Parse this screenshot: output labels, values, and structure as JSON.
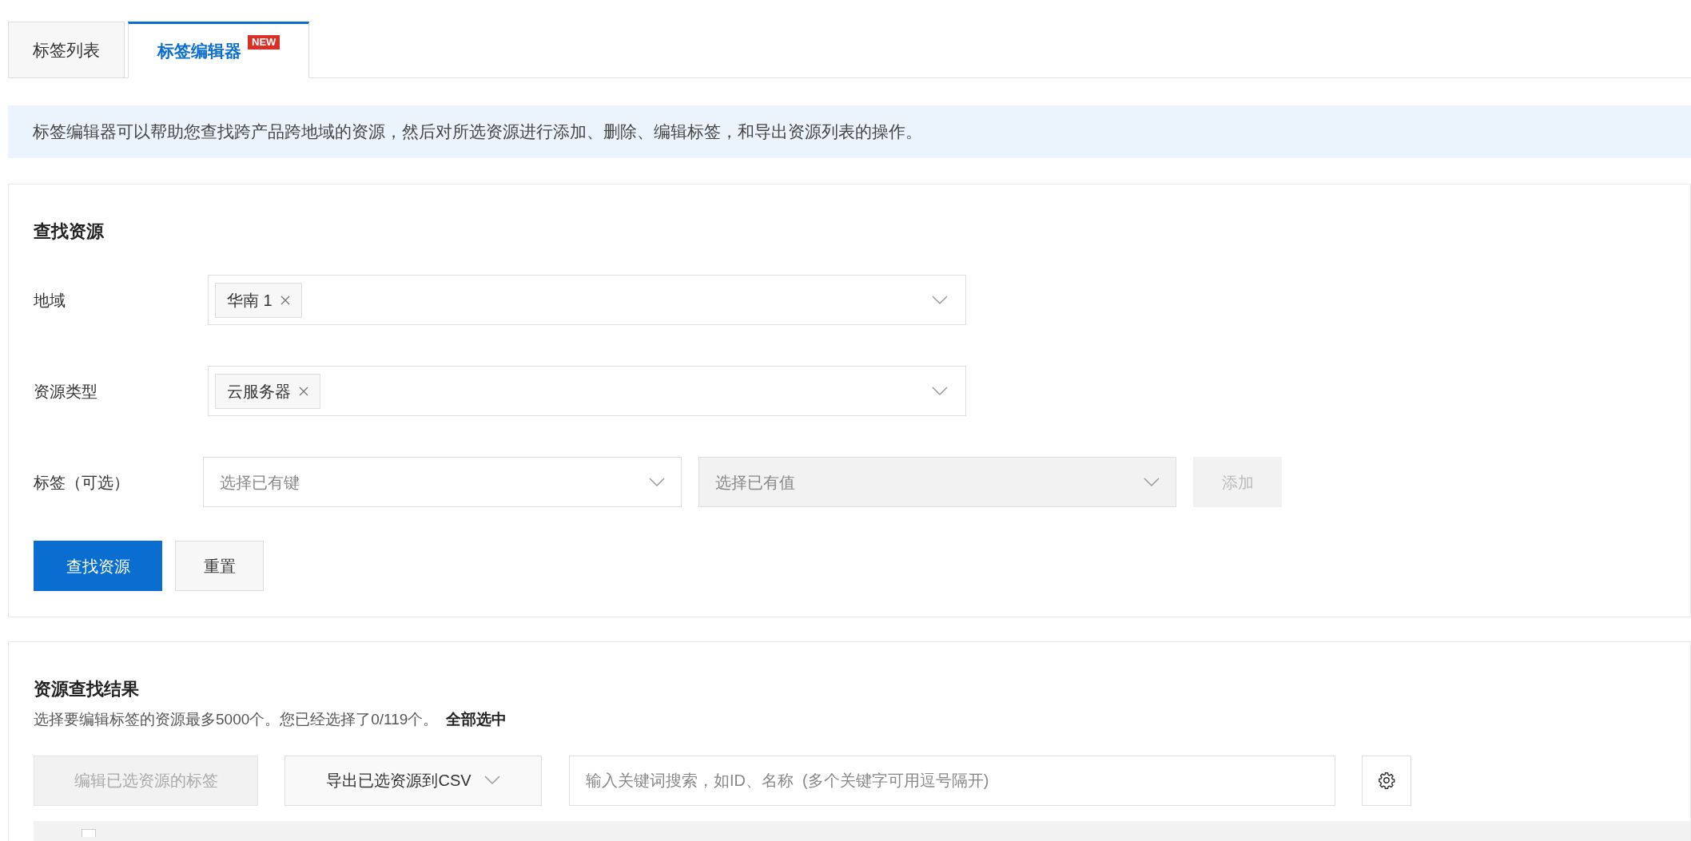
{
  "tabs": [
    {
      "label": "标签列表",
      "selected": false
    },
    {
      "label": "标签编辑器",
      "selected": true,
      "badge": "NEW"
    }
  ],
  "notice": "标签编辑器可以帮助您查找跨产品跨地域的资源，然后对所选资源进行添加、删除、编辑标签，和导出资源列表的操作。",
  "find_panel": {
    "title": "查找资源",
    "fields": [
      {
        "label": "地域",
        "tags": [
          "华南 1"
        ]
      },
      {
        "label": "资源类型",
        "tags": [
          "云服务器"
        ]
      }
    ],
    "tag_filter": {
      "label": "标签（可选）",
      "key_placeholder": "选择已有键",
      "value_placeholder": "选择已有值",
      "value_disabled": true,
      "add_label": "添加",
      "add_disabled": true
    },
    "buttons": [
      {
        "label": "查找资源",
        "kind": "primary"
      },
      {
        "label": "重置",
        "kind": "default"
      }
    ]
  },
  "results": {
    "title": "资源查找结果",
    "summary": "选择要编辑标签的资源最多5000个。您已经选择了0/119个。",
    "select_all": "全部选中",
    "edit_button": {
      "label": "编辑已选资源的标签",
      "disabled": true
    },
    "export_button": {
      "label": "导出已选资源到CSV"
    },
    "search": {
      "placeholder": "输入关键词搜索，如ID、名称  (多个关键字可用逗号隔开)"
    },
    "header_checkbox": {
      "checked": false
    }
  }
}
